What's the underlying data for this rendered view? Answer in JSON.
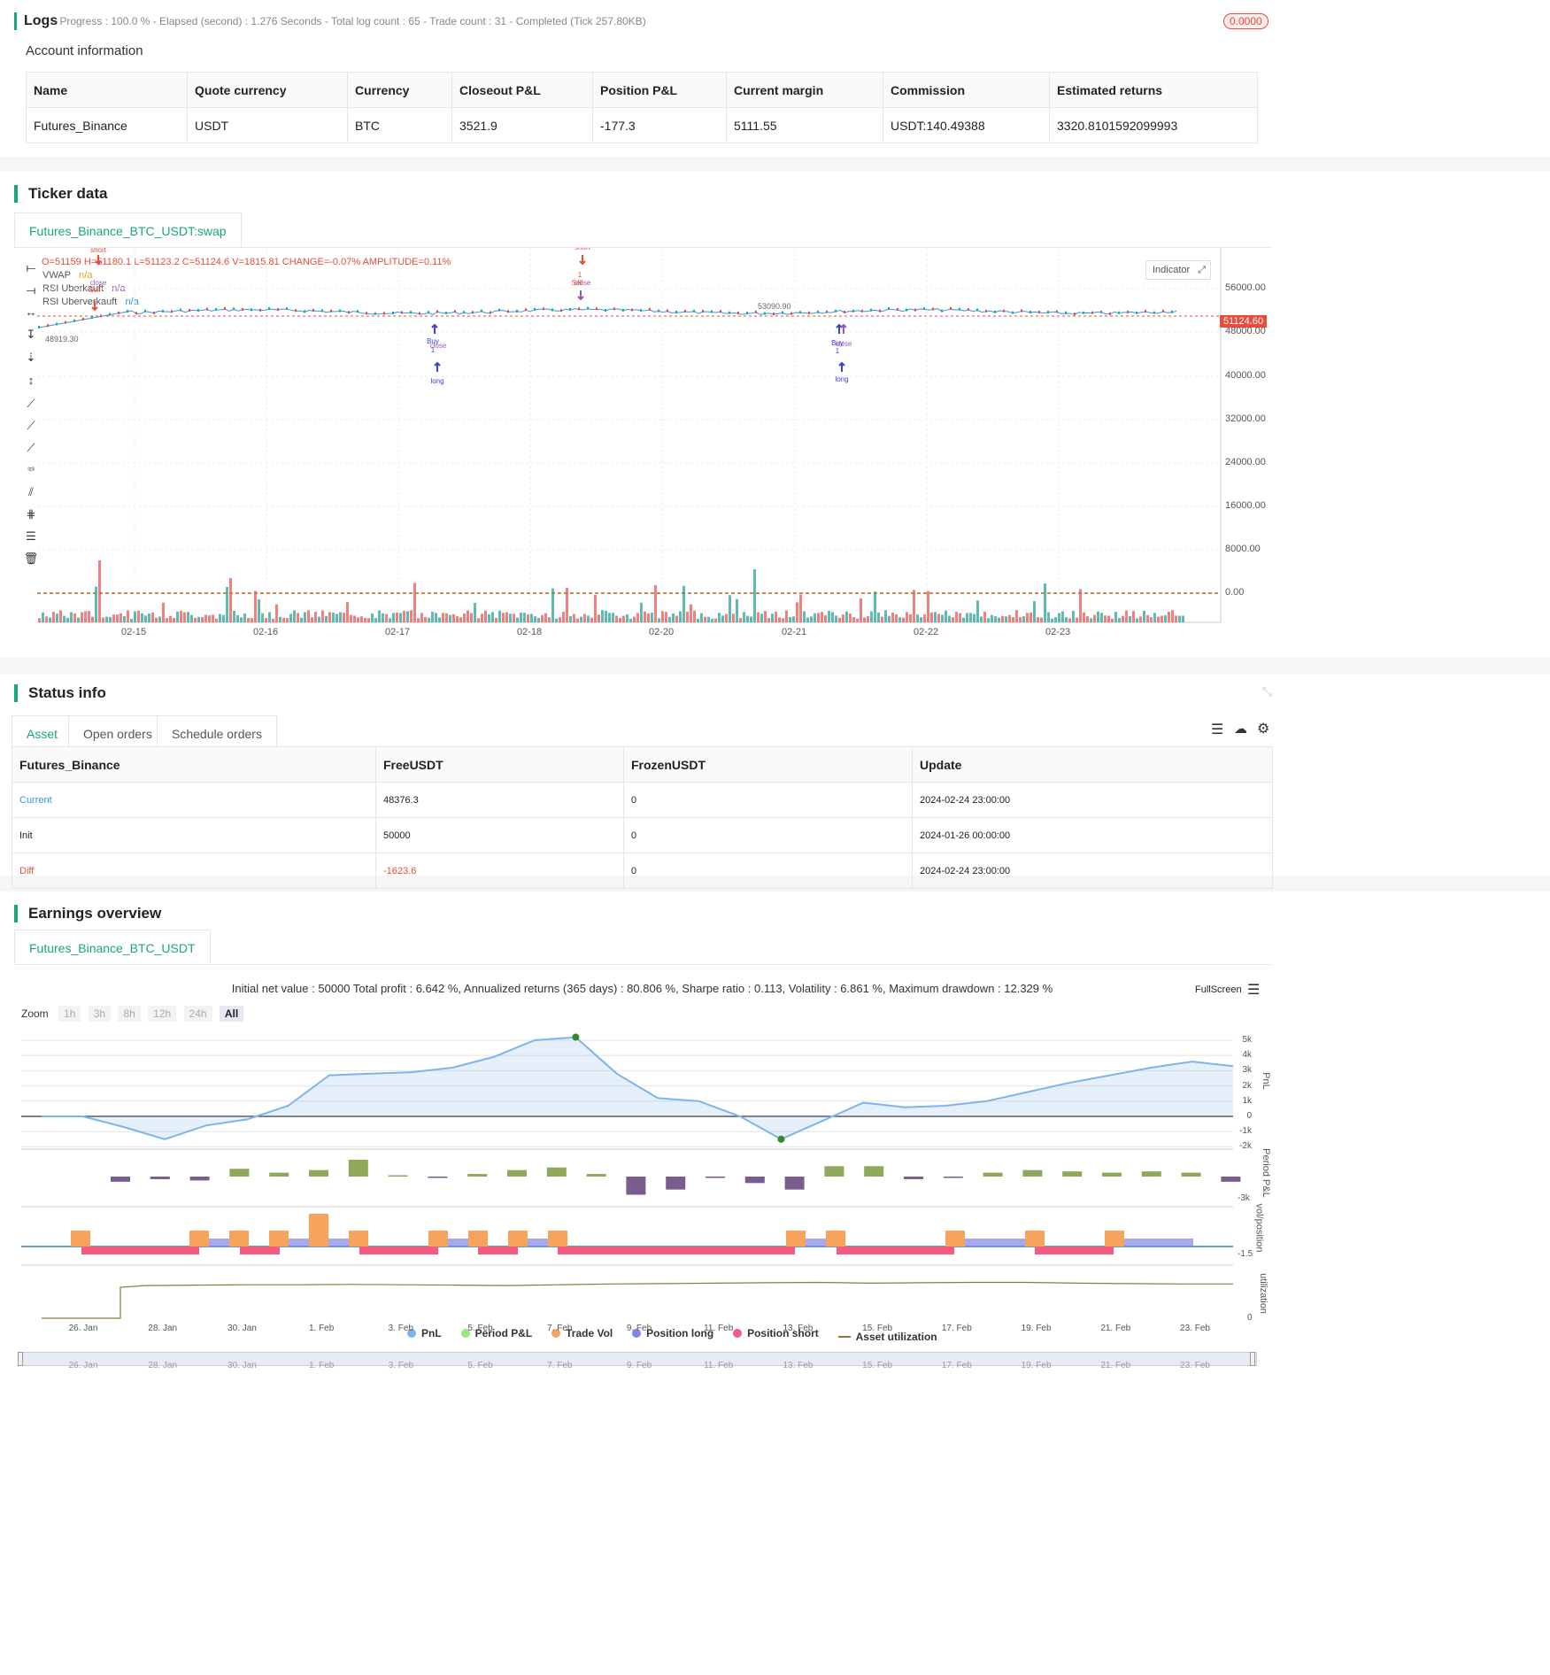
{
  "logs": {
    "title": "Logs",
    "summary": "- Progress : 100.0 % - Elapsed (second) : 1.276  Seconds - Total log count : 65 - Trade count : 31 - Completed (Tick 257.80KB)",
    "badge": "0.0000"
  },
  "account": {
    "title": "Account information",
    "headers": [
      "Name",
      "Quote currency",
      "Currency",
      "Closeout P&L",
      "Position P&L",
      "Current margin",
      "Commission",
      "Estimated returns"
    ],
    "row": [
      "Futures_Binance",
      "USDT",
      "BTC",
      "3521.9",
      "-177.3",
      "5111.55",
      "USDT:140.49388",
      "3320.8101592099993"
    ]
  },
  "ticker": {
    "title": "Ticker data",
    "tab": "Futures_Binance_BTC_USDT:swap",
    "ohlc": {
      "o": "O=51159",
      "h": "H=51180.1",
      "l": "L=51123.2",
      "c": "C=51124.6",
      "v": "V=1815.81",
      "change": "CHANGE=-0.07%",
      "amplitude": "AMPLITUDE=0.11%"
    },
    "indicators": [
      {
        "name": "VWAP",
        "value": "n/a",
        "color": "#f39c12"
      },
      {
        "name": "RSI Uberkauft",
        "value": "n/a",
        "color": "#9b59b6"
      },
      {
        "name": "RSI Uberverkauft",
        "value": "n/a",
        "color": "#3498db"
      }
    ],
    "indicator_button": "Indicator",
    "price_label": "51124.60",
    "high_mark": "53090.90",
    "low_mark": "48919.30",
    "y_ticks": [
      "56000.00",
      "48000.00",
      "40000.00",
      "32000.00",
      "24000.00",
      "16000.00",
      "8000.00",
      "0.00"
    ],
    "x_ticks": [
      "02-15",
      "02-16",
      "02-17",
      "02-18",
      "02-20",
      "02-21",
      "02-22",
      "02-23"
    ],
    "markers": {
      "short": "short",
      "close": "close",
      "sell": "Sell",
      "buy": "Buy",
      "long": "long",
      "one": "1"
    }
  },
  "status": {
    "title": "Status info",
    "tabs": [
      "Asset",
      "Open orders",
      "Schedule orders"
    ],
    "headers": [
      "Futures_Binance",
      "FreeUSDT",
      "FrozenUSDT",
      "Update"
    ],
    "rows": [
      [
        "Current",
        "48376.3",
        "0",
        "2024-02-24 23:00:00"
      ],
      [
        "Init",
        "50000",
        "0",
        "2024-01-26 00:00:00"
      ],
      [
        "Diff",
        "-1623.6",
        "0",
        "2024-02-24 23:00:00"
      ]
    ]
  },
  "earnings": {
    "title": "Earnings overview",
    "tab": "Futures_Binance_BTC_USDT",
    "summary": "Initial net value : 50000 Total profit : 6.642 %, Annualized returns (365 days) : 80.806 %, Sharpe ratio : 0.113, Volatility : 6.861 %, Maximum drawdown : 12.329 %",
    "fullscreen": "FullScreen",
    "zoom_label": "Zoom",
    "zoom_buttons": [
      "1h",
      "3h",
      "8h",
      "12h",
      "24h",
      "All"
    ],
    "pnl_ticks": [
      "5k",
      "4k",
      "3k",
      "2k",
      "1k",
      "0",
      "-1k",
      "-2k"
    ],
    "period_tick": "-3k",
    "vol_tick": "-1.5",
    "util_tick": "0",
    "axis_titles": [
      "PnL",
      "Period P&L",
      "vol/position",
      "utilization"
    ],
    "x_ticks": [
      "26. Jan",
      "28. Jan",
      "30. Jan",
      "1. Feb",
      "3. Feb",
      "5. Feb",
      "7. Feb",
      "9. Feb",
      "11. Feb",
      "13. Feb",
      "15. Feb",
      "17. Feb",
      "19. Feb",
      "21. Feb",
      "23. Feb"
    ],
    "legend": [
      {
        "label": "PnL",
        "color": "#7cb5ec"
      },
      {
        "label": "Period P&L",
        "color": "#90ed7d"
      },
      {
        "label": "Trade Vol",
        "color": "#f7a35c"
      },
      {
        "label": "Position long",
        "color": "#8085e9"
      },
      {
        "label": "Position short",
        "color": "#f15c80"
      },
      {
        "label": "Asset utilization",
        "color": "#8d7a3e"
      }
    ]
  },
  "chart_data": [
    {
      "type": "line",
      "title": "",
      "series": [
        {
          "name": "PnL",
          "values": [
            0,
            0,
            -700,
            -1500,
            -600,
            -200,
            700,
            2700,
            2800,
            2900,
            3200,
            3900,
            5000,
            5200,
            2800,
            1200,
            1000,
            0,
            -1500,
            -300,
            900,
            600,
            700,
            1000,
            1600,
            2200,
            2700,
            3200,
            3600,
            3300
          ]
        }
      ],
      "ylim": [
        -2000,
        5500
      ],
      "xlabel": "",
      "ylabel": "PnL"
    },
    {
      "type": "bar",
      "series": [
        {
          "name": "Period P&L",
          "values": [
            -400,
            -200,
            -300,
            600,
            300,
            500,
            1300,
            100,
            -100,
            200,
            500,
            700,
            200,
            -1400,
            -1000,
            -100,
            -500,
            -1000,
            800,
            800,
            -200,
            -50,
            300,
            500,
            400,
            300,
            400,
            300,
            -400
          ]
        }
      ]
    },
    {
      "type": "line",
      "series": [
        {
          "name": "Asset utilization",
          "values": [
            0,
            0,
            0.82,
            0.83,
            0.84,
            0.84,
            0.85,
            0.84,
            0.83,
            0.82,
            0.84,
            0.86,
            0.87,
            0.88,
            0.89,
            0.9,
            0.88,
            0.89,
            0.9,
            0.9,
            0.88,
            0.87,
            0.86,
            0.86
          ]
        }
      ]
    }
  ]
}
